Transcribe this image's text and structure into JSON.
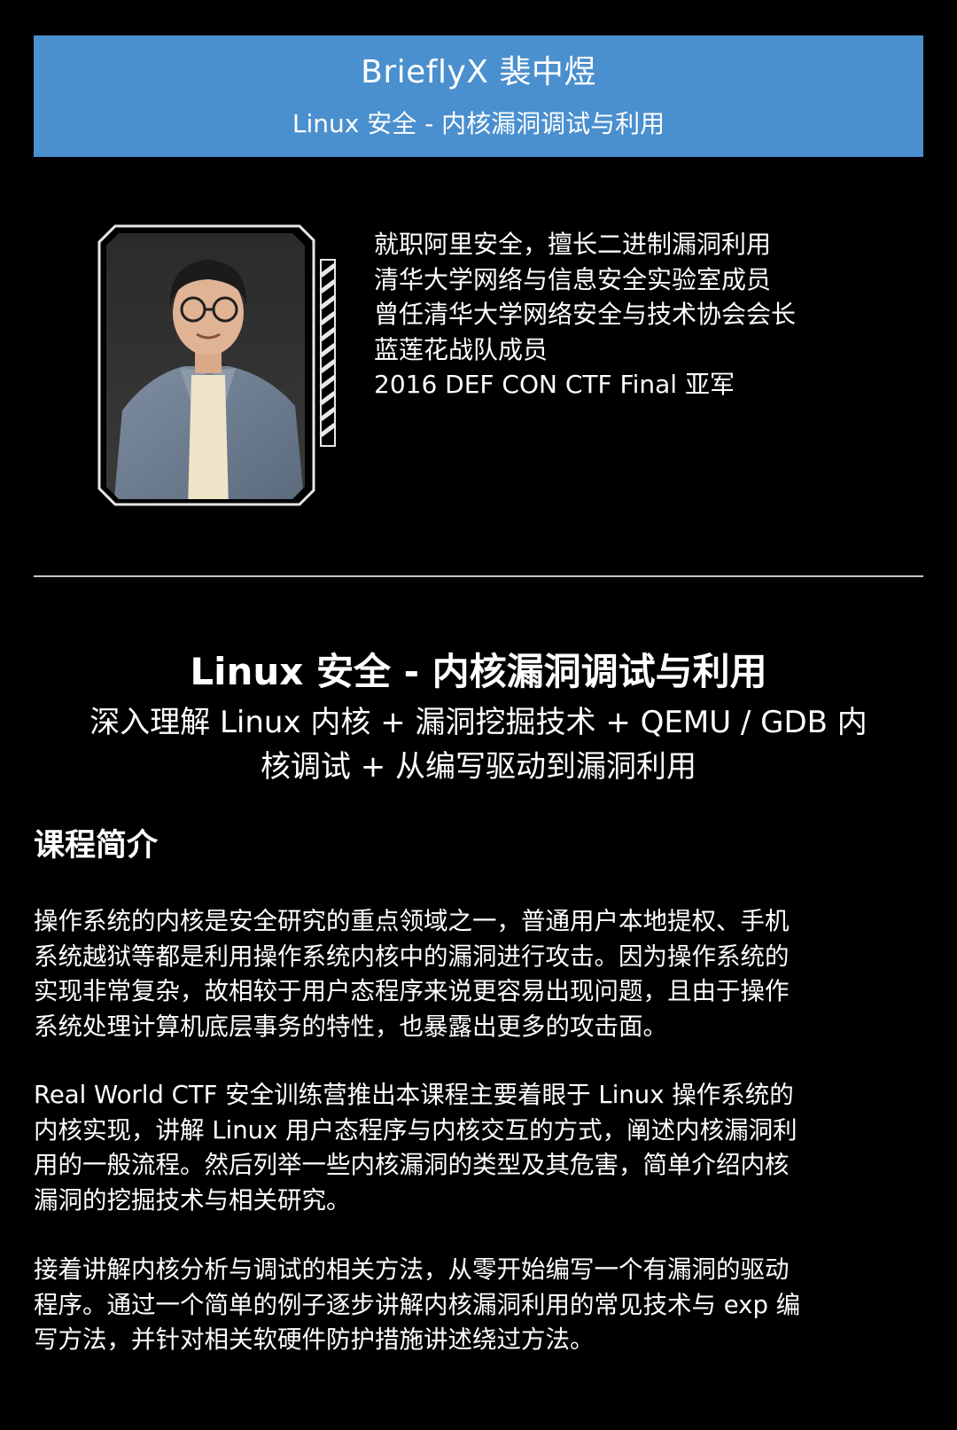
{
  "header": {
    "name": "BrieflyX 裴中煜",
    "subtitle": "Linux 安全 - 内核漏洞调试与利用"
  },
  "speaker": {
    "bio_lines": [
      "就职阿里安全，擅长二进制漏洞利用",
      "清华大学网络与信息安全实验室成员",
      "曾任清华大学网络安全与技术协会会长",
      "蓝莲花战队成员",
      "2016 DEF CON CTF Final 亚军"
    ]
  },
  "course": {
    "title": "Linux 安全 - 内核漏洞调试与利用",
    "subtitle_lines": [
      "深入理解 Linux 内核 + 漏洞挖掘技术 + QEMU / GDB 内",
      "核调试 + 从编写驱动到漏洞利用"
    ]
  },
  "intro": {
    "heading": "课程简介",
    "paragraphs": [
      {
        "lines": [
          "操作系统的内核是安全研究的重点领域之一，普通用户本地提权、手机",
          "系统越狱等都是利用操作系统内核中的漏洞进行攻击。因为操作系统的",
          "实现非常复杂，故相较于用户态程序来说更容易出现问题，且由于操作",
          "系统处理计算机底层事务的特性，也暴露出更多的攻击面。"
        ]
      },
      {
        "lines": [
          "Real World CTF 安全训练营推出本课程主要着眼于 Linux 操作系统的",
          "内核实现，讲解 Linux 用户态程序与内核交互的方式，阐述内核漏洞利",
          "用的一般流程。然后列举一些内核漏洞的类型及其危害，简单介绍内核",
          "漏洞的挖掘技术与相关研究。"
        ]
      },
      {
        "lines": [
          "接着讲解内核分析与调试的相关方法，从零开始编写一个有漏洞的驱动",
          "程序。通过一个简单的例子逐步讲解内核漏洞利用的常见技术与 exp 编",
          "写方法，并针对相关软硬件防护措施讲述绕过方法。"
        ]
      }
    ]
  },
  "colors": {
    "background": "#000000",
    "banner": "#4a8fce",
    "text": "#ffffff",
    "divider": "#c8c8c8"
  }
}
